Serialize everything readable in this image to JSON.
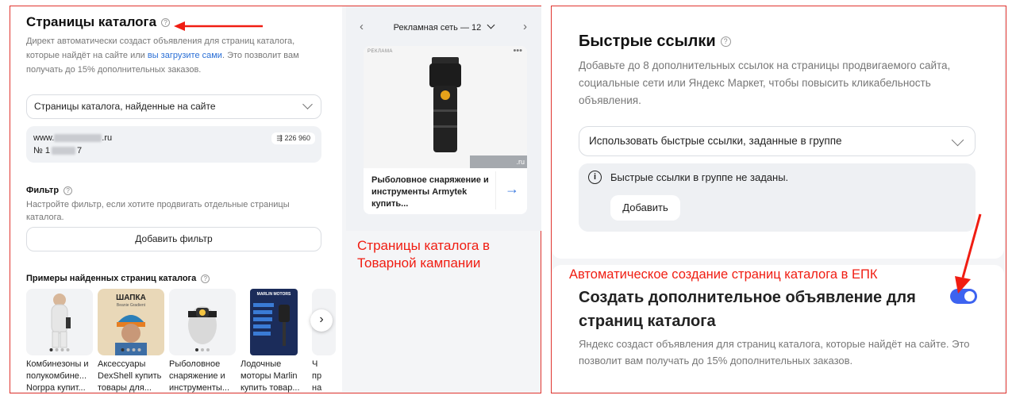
{
  "left": {
    "title": "Страницы каталога",
    "description_part1": "Директ автоматически создаст объявления для страниц каталога, которые найдёт на сайте или ",
    "description_link": "вы загрузите сами",
    "description_part2": ". Это позволит вам получать до 15% дополнительных заказов.",
    "select_value": "Страницы каталога, найденные на сайте",
    "site_prefix": "www.",
    "site_suffix": ".ru",
    "site_number_prefix": "№ 1",
    "site_number_suffix": "7",
    "site_count": "226 960",
    "filter_title": "Фильтр",
    "filter_desc": "Настройте фильтр, если хотите продвигать отдельные страницы каталога.",
    "add_filter_label": "Добавить фильтр",
    "examples_title": "Примеры найденных страниц каталога",
    "examples": [
      {
        "name": "Комбинезоны и полукомбине... Norppa купит..."
      },
      {
        "name": "Аксессуары DexShell купить товары для..."
      },
      {
        "name": "Рыболовное снаряжение и инструменты..."
      },
      {
        "name": "Лодочные моторы Marlin купить товар..."
      },
      {
        "name": "Ч пр на"
      }
    ],
    "example_texts": {
      "hat": "ШАПКА",
      "hat_sub": "Beanie Gradient",
      "marlin": "MARLIN MOTORS"
    },
    "next_glyph": "›"
  },
  "preview": {
    "network_label": "Рекламная сеть — 12",
    "prev_glyph": "‹",
    "next_glyph": "›",
    "ad_tag": "РЕКЛАМА",
    "ad_more": "•••",
    "ad_domain": ".ru",
    "ad_title": "Рыболовное снаряжение и инструменты Armytek купить...",
    "ad_arrow": "→",
    "caption": "Страницы каталога в Товарной кампании"
  },
  "right": {
    "title": "Быстрые ссылки",
    "description": "Добавьте до 8 дополнительных ссылок на страницы продвигаемого сайта, социальные сети или Яндекс Маркет, чтобы повысить кликабельность объявления.",
    "select_value": "Использовать быстрые ссылки, заданные в группе",
    "info_icon": "i",
    "info_text": "Быстрые ссылки в группе не заданы.",
    "add_label": "Добавить",
    "caption": "Автоматическое создание страниц каталога в ЕПК",
    "toggle_title": "Создать дополнительное объявление для страниц каталога",
    "toggle_on": true,
    "toggle_desc": "Яндекс создаст объявления для страниц каталога, которые найдёт на сайте. Это позволит вам получать до 15% дополнительных заказов."
  },
  "colors": {
    "accent": "#3d63f0",
    "link": "#2a6fd6",
    "annotation": "#f01d12"
  }
}
